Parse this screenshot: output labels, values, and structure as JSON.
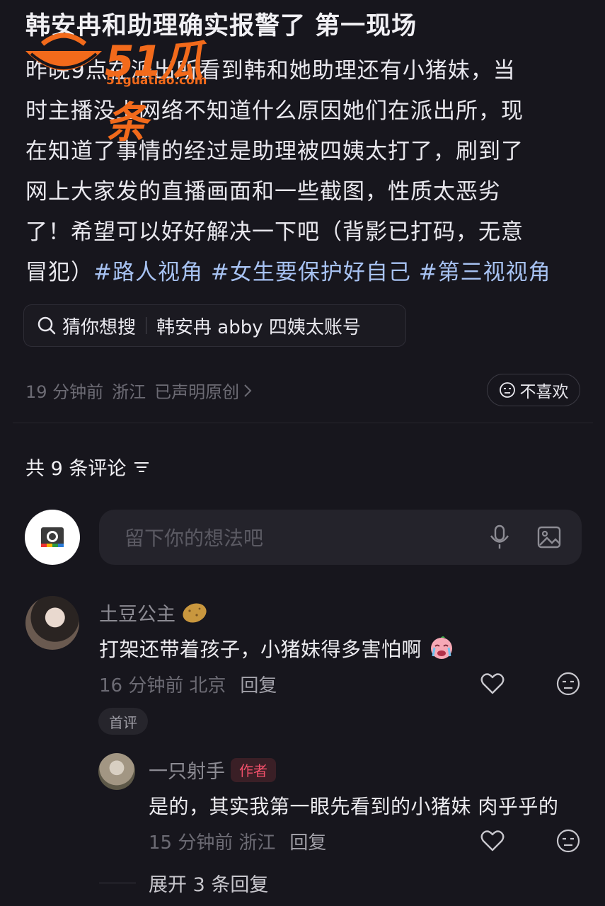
{
  "post": {
    "title": "韩安冉和助理确实报警了 第一现场",
    "body_lines": [
      "昨晚9点在派出所看到韩和她助理还有小猪妹，当",
      "时主播没上网络不知道什么原因她们在派出所，现",
      "在知道了事情的经过是助理被四姨太打了，刷到了",
      "网上大家发的直播画面和一些截图，性质太恶劣",
      "了！希望可以好好解决一下吧（背影已打码，无意"
    ],
    "last_line_prefix": "冒犯）",
    "hashtags": [
      "#路人视角",
      "#女生要保护好自己",
      "#第三视视角"
    ]
  },
  "watermark": {
    "brand": "51瓜条",
    "url": "51guatiao.com"
  },
  "search_chip": {
    "label": "猜你想搜",
    "query": "韩安冉 abby 四姨太账号"
  },
  "meta": {
    "time": "19 分钟前",
    "location": "浙江",
    "original": "已声明原创"
  },
  "dislike_label": "不喜欢",
  "comments_header": "共 9 条评论",
  "comment_input_placeholder": "留下你的想法吧",
  "comments": [
    {
      "user": "土豆公主",
      "text": "打架还带着孩子，小猪妹得多害怕啊",
      "time": "16 分钟前",
      "location": "北京",
      "reply_label": "回复",
      "badge": "首评"
    }
  ],
  "reply": {
    "user": "一只射手",
    "author_badge": "作者",
    "text": "是的，其实我第一眼先看到的小猪妹 肉乎乎的",
    "time": "15 分钟前",
    "location": "浙江",
    "reply_label": "回复"
  },
  "expand_label": "展开 3 条回复",
  "colors": {
    "background": "#17161d",
    "hashtag": "#a7c2f2",
    "watermark": "#f26a1b",
    "author_badge": "#f2506a"
  }
}
